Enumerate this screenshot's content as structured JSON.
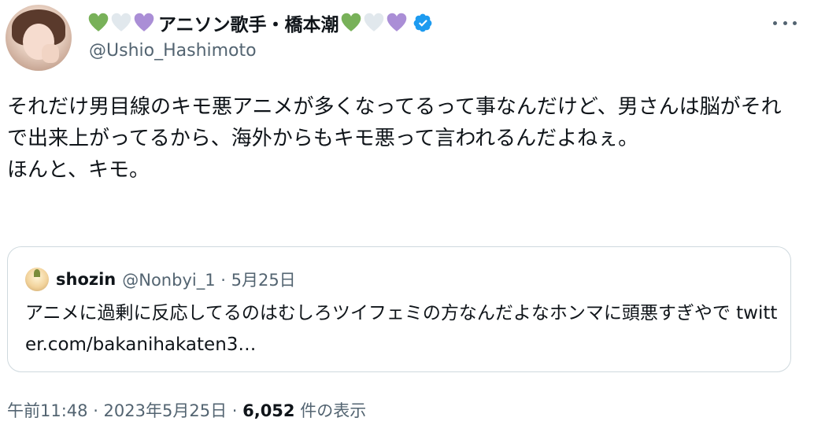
{
  "author": {
    "name_prefix_hearts": [
      "green",
      "white",
      "purple"
    ],
    "name": "アニソン歌手・橋本潮",
    "name_suffix_hearts": [
      "green",
      "white",
      "purple"
    ],
    "handle": "@Ushio_Hashimoto",
    "verified_icon": "verified-badge-icon",
    "avatar_icon": "profile-photo"
  },
  "colors": {
    "green_heart": "#78b159",
    "white_heart": "#e1e8ed",
    "purple_heart": "#aa8ed6",
    "verified": "#1d9bf0",
    "secondary_text": "#536471",
    "border": "#cfd9de"
  },
  "tweet": {
    "text": "それだけ男目線のキモ悪アニメが多くなってるって事なんだけど、男さんは脳がそれで出来上がってるから、海外からもキモ悪って言われるんだよねぇ。\nほんと、キモ。"
  },
  "quote": {
    "name": "shozin",
    "meta": "@Nonbyi_1 · 5月25日",
    "text": "アニメに過剰に反応してるのはむしろツイフェミの方なんだよなホンマに頭悪すぎやで twitter.com/bakanihakaten3…"
  },
  "footer": {
    "time": "午前11:48 · 2023年5月25日 · ",
    "views_count": "6,052",
    "views_label": " 件の表示"
  },
  "menu": {
    "icon": "more-options-icon"
  }
}
